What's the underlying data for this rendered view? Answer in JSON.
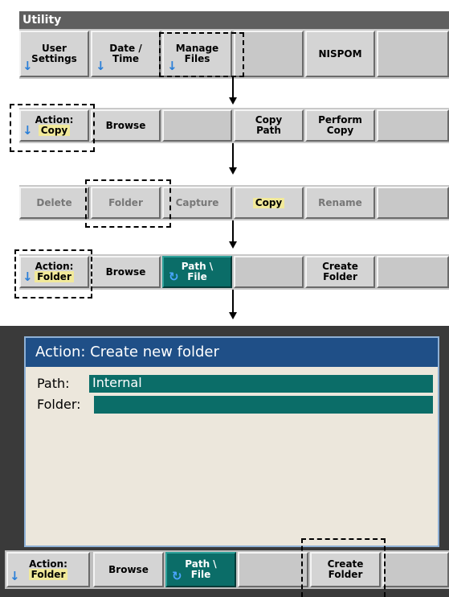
{
  "row1": {
    "title": "Utility",
    "keys": [
      {
        "line1": "User",
        "line2": "Settings"
      },
      {
        "line1": "Date /",
        "line2": "Time"
      },
      {
        "line1": "Manage",
        "line2": "Files"
      },
      {
        "line1": "",
        "line2": ""
      },
      {
        "line1": "NISPOM",
        "line2": ""
      },
      {
        "line1": "",
        "line2": ""
      }
    ]
  },
  "row2": {
    "action_label": "Action:",
    "action_value": "Copy",
    "browse": "Browse",
    "copy_path_1": "Copy",
    "copy_path_2": "Path",
    "perform_copy_1": "Perform",
    "perform_copy_2": "Copy"
  },
  "row3": {
    "delete": "Delete",
    "folder": "Folder",
    "capture": "Capture",
    "copy": "Copy",
    "rename": "Rename"
  },
  "row4": {
    "action_label": "Action:",
    "action_value": "Folder",
    "browse": "Browse",
    "path_file_1": "Path \\",
    "path_file_2": "File",
    "create_folder_1": "Create",
    "create_folder_2": "Folder"
  },
  "dialog": {
    "title": "Action: Create new folder",
    "path_label": "Path:",
    "path_value": "Internal",
    "folder_label": "Folder:",
    "folder_value": ""
  },
  "row5": {
    "action_label": "Action:",
    "action_value": "Folder",
    "browse": "Browse",
    "path_file_1": "Path \\",
    "path_file_2": "File",
    "create_folder_1": "Create",
    "create_folder_2": "Folder"
  },
  "colors": {
    "teal": "#0b6d68",
    "title_blue": "#1f4f87",
    "highlight": "#f1e99a",
    "arrow_blue": "#2a7fd8"
  }
}
